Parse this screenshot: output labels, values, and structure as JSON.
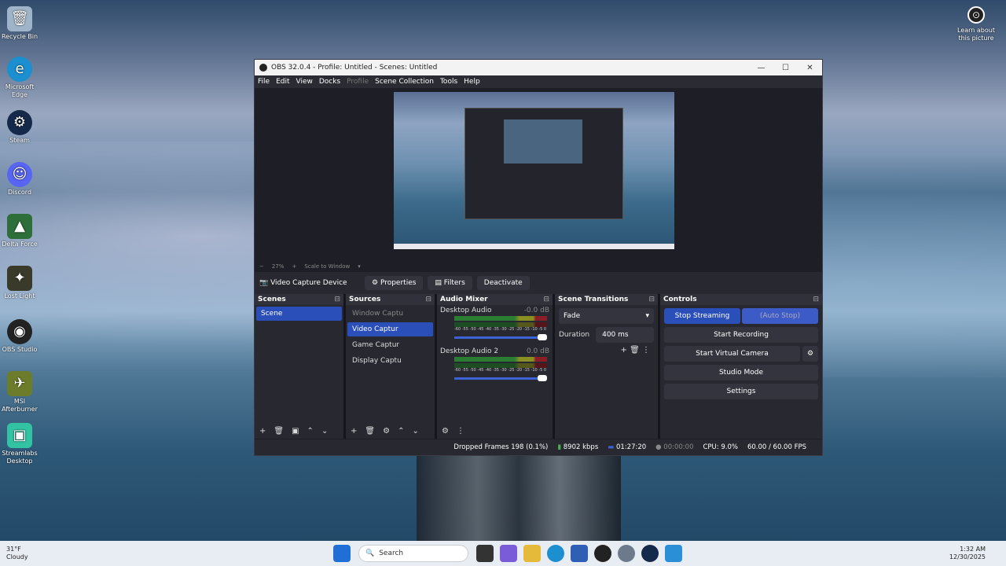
{
  "desktop": {
    "icons": [
      "Recycle Bin",
      "Microsoft Edge",
      "Steam",
      "Discord",
      "Delta Force",
      "Lost Light",
      "OBS Studio",
      "MSI Afterburner",
      "Streamlabs Desktop"
    ],
    "learn": "Learn about this picture"
  },
  "obs": {
    "title": "OBS 32.0.4 - Profile: Untitled - Scenes: Untitled",
    "menu": [
      "File",
      "Edit",
      "View",
      "Docks",
      "Profile",
      "Scene Collection",
      "Tools",
      "Help"
    ],
    "zoom": "27%",
    "scale": "Scale to Window",
    "source_name": "Video Capture Device",
    "properties": "Properties",
    "filters": "Filters",
    "deactivate": "Deactivate",
    "docks": {
      "scenes": "Scenes",
      "sources": "Sources",
      "mixer": "Audio Mixer",
      "transitions": "Scene Transitions",
      "controls": "Controls"
    },
    "scenes": [
      "Scene"
    ],
    "sources": [
      "Window Captu",
      "Video Captur",
      "Game Captur",
      "Display Captu"
    ],
    "mixer": [
      {
        "name": "Desktop Audio",
        "db": "-0.0 dB",
        "scale": "-60 -55 -50 -45 -40 -35 -30 -25 -20 -15 -10 -5 0"
      },
      {
        "name": "Desktop Audio 2",
        "db": "0.0 dB",
        "scale": "-60 -55 -50 -45 -40 -35 -30 -25 -20 -15 -10 -5 0"
      }
    ],
    "transition": "Fade",
    "duration_label": "Duration",
    "duration": "400 ms",
    "controls": {
      "stop_streaming": "Stop Streaming",
      "auto_stop": "(Auto Stop)",
      "start_recording": "Start Recording",
      "start_virtual": "Start Virtual Camera",
      "studio_mode": "Studio Mode",
      "settings": "Settings"
    },
    "status": {
      "dropped": "Dropped Frames 198 (0.1%)",
      "kbps": "8902 kbps",
      "stream_time": "01:27:20",
      "rec_time": "00:00:00",
      "cpu": "CPU: 9.0%",
      "fps": "60.00 / 60.00 FPS"
    }
  },
  "taskbar": {
    "temp": "31°F",
    "weather": "Cloudy",
    "search": "Search",
    "time": "1:32 AM",
    "date": "12/30/2025"
  }
}
